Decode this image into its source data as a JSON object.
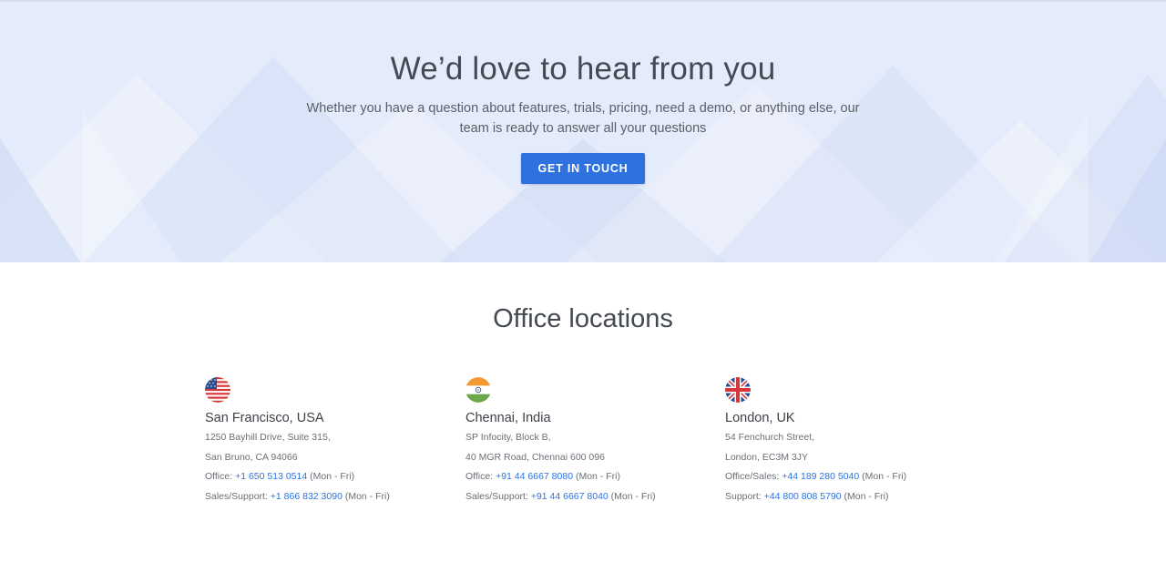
{
  "hero": {
    "title": "We’d love to hear from you",
    "subtitle": "Whether you have a question about features, trials, pricing, need a demo, or anything else, our team is ready to answer all your questions",
    "cta_label": "GET IN TOUCH"
  },
  "offices_section": {
    "title": "Office locations",
    "offices": [
      {
        "flag": "usa-flag-icon",
        "city": "San Francisco, USA",
        "address_line1": "1250 Bayhill Drive, Suite 315,",
        "address_line2": "San Bruno, CA 94066",
        "contact1_label": "Office: ",
        "contact1_phone": "+1 650 513 0514",
        "contact1_hours": " (Mon - Fri)",
        "contact2_label": "Sales/Support: ",
        "contact2_phone": "+1 866 832 3090",
        "contact2_hours": " (Mon - Fri)"
      },
      {
        "flag": "india-flag-icon",
        "city": "Chennai, India",
        "address_line1": "SP Infocity, Block B,",
        "address_line2": "40 MGR Road, Chennai 600 096",
        "contact1_label": "Office: ",
        "contact1_phone": "+91 44 6667 8080",
        "contact1_hours": " (Mon - Fri)",
        "contact2_label": "Sales/Support: ",
        "contact2_phone": "+91 44 6667 8040",
        "contact2_hours": " (Mon - Fri)"
      },
      {
        "flag": "uk-flag-icon",
        "city": "London, UK",
        "address_line1": "54 Fenchurch Street,",
        "address_line2": "London, EC3M 3JY",
        "contact1_label": "Office/Sales: ",
        "contact1_phone": "+44 189 280 5040",
        "contact1_hours": " (Mon - Fri)",
        "contact2_label": "Support: ",
        "contact2_phone": "+44 800 808 5790",
        "contact2_hours": " (Mon - Fri)"
      }
    ]
  },
  "colors": {
    "accent": "#2e72e0",
    "hero_bg": "#e4ebfa",
    "heading": "#444a52"
  }
}
